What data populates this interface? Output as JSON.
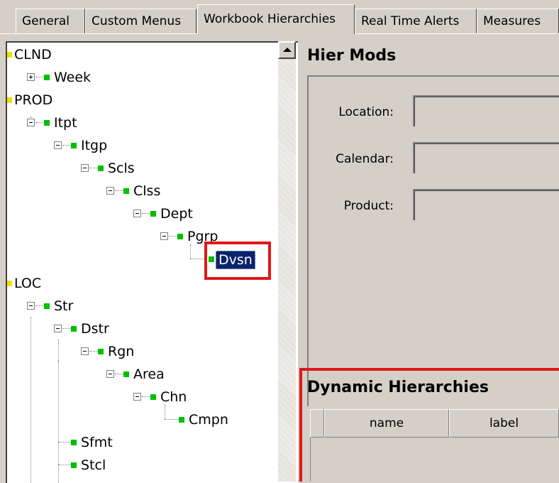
{
  "tabs": [
    {
      "label": "General",
      "active": false
    },
    {
      "label": "Custom Menus",
      "active": false
    },
    {
      "label": "Workbook Hierarchies",
      "active": true
    },
    {
      "label": "Real Time Alerts",
      "active": false
    },
    {
      "label": "Measures",
      "active": false
    }
  ],
  "tree": {
    "nodes": [
      {
        "label": "CLND",
        "kind": "root"
      },
      {
        "label": "Week",
        "kind": "node",
        "expander": "plus"
      },
      {
        "label": "PROD",
        "kind": "root"
      },
      {
        "label": "Itpt",
        "kind": "node",
        "expander": "minus"
      },
      {
        "label": "Itgp",
        "kind": "node",
        "expander": "minus"
      },
      {
        "label": "Scls",
        "kind": "node",
        "expander": "minus"
      },
      {
        "label": "Clss",
        "kind": "node",
        "expander": "minus"
      },
      {
        "label": "Dept",
        "kind": "node",
        "expander": "minus"
      },
      {
        "label": "Pgrp",
        "kind": "node",
        "expander": "minus"
      },
      {
        "label": "Dvsn",
        "kind": "node",
        "selected": true
      },
      {
        "label": "LOC",
        "kind": "root"
      },
      {
        "label": "Str",
        "kind": "node",
        "expander": "minus"
      },
      {
        "label": "Dstr",
        "kind": "node",
        "expander": "minus"
      },
      {
        "label": "Rgn",
        "kind": "node",
        "expander": "minus"
      },
      {
        "label": "Area",
        "kind": "node",
        "expander": "minus"
      },
      {
        "label": "Chn",
        "kind": "node",
        "expander": "minus"
      },
      {
        "label": "Cmpn",
        "kind": "node"
      },
      {
        "label": "Sfmt",
        "kind": "node"
      },
      {
        "label": "Stcl",
        "kind": "node"
      }
    ]
  },
  "hier_mods": {
    "title": "Hier Mods",
    "fields": [
      {
        "label": "Location:",
        "value": ""
      },
      {
        "label": "Calendar:",
        "value": ""
      },
      {
        "label": "Product:",
        "value": ""
      }
    ]
  },
  "dynamic": {
    "title": "Dynamic Hierarchies",
    "columns": [
      "name",
      "label"
    ]
  },
  "colors": {
    "highlight_box": "#e01818",
    "selection": "#0a246a",
    "node_icon": "#00c000",
    "root_icon": "#f0e000"
  }
}
